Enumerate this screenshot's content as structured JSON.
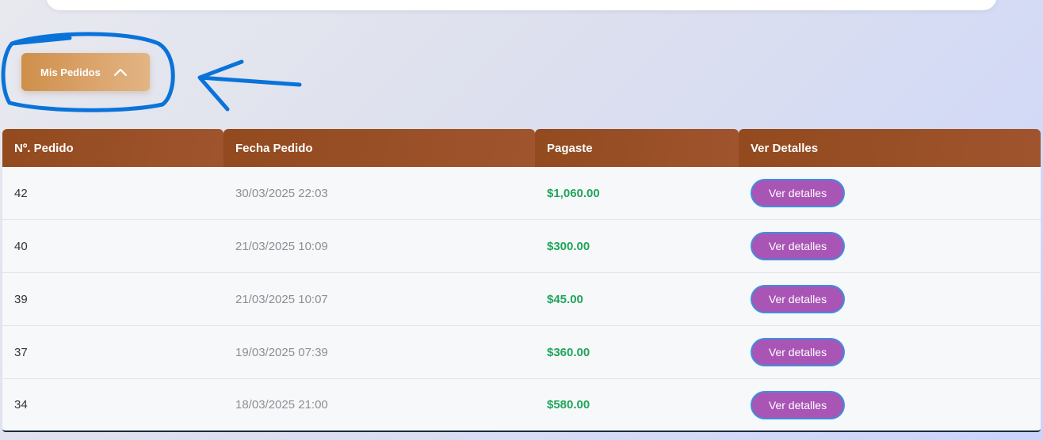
{
  "orders_toggle": {
    "label": "Mis Pedidos",
    "icon": "chevron-up-icon"
  },
  "table": {
    "headers": [
      "Nº. Pedido",
      "Fecha Pedido",
      "Pagaste",
      "Ver Detalles"
    ],
    "rows": [
      {
        "id": "42",
        "date": "30/03/2025 22:03",
        "paid": "$1,060.00",
        "action": "Ver detalles"
      },
      {
        "id": "40",
        "date": "21/03/2025 10:09",
        "paid": "$300.00",
        "action": "Ver detalles"
      },
      {
        "id": "39",
        "date": "21/03/2025 10:07",
        "paid": "$45.00",
        "action": "Ver detalles"
      },
      {
        "id": "37",
        "date": "19/03/2025 07:39",
        "paid": "$360.00",
        "action": "Ver detalles"
      },
      {
        "id": "34",
        "date": "18/03/2025 21:00",
        "paid": "$580.00",
        "action": "Ver detalles"
      }
    ]
  },
  "colors": {
    "header_bg": "#924a1e",
    "toggle_bg": "#cf8f4b",
    "paid_text": "#1fa55a",
    "details_button_bg": "#a855b5",
    "annotation": "#0a73d9"
  }
}
